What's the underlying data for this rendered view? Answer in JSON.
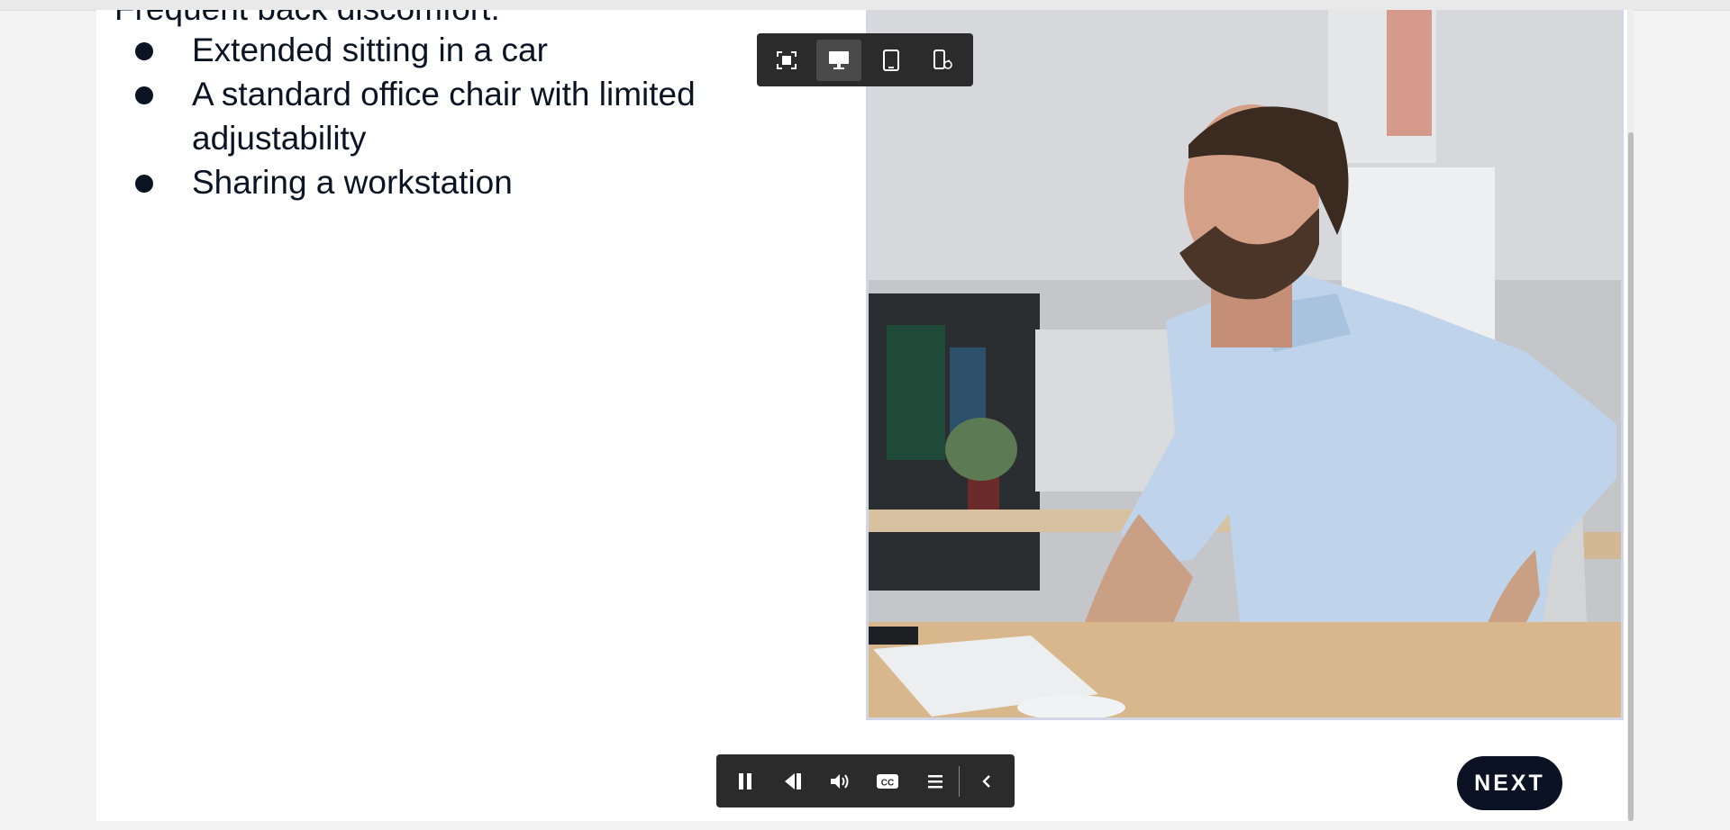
{
  "slide": {
    "cut_line": "Frequent back discomfort:",
    "bullets": [
      {
        "text": "Extended sitting in a car"
      },
      {
        "text": "A standard office chair with limited adjustability"
      },
      {
        "text": "Sharing a workstation"
      }
    ]
  },
  "preview_toolbar": {
    "buttons": [
      "fit-screen-icon",
      "desktop-icon",
      "tablet-icon",
      "mobile-rotate-icon"
    ],
    "active": "desktop-icon"
  },
  "player_controls": {
    "buttons": [
      "pause-icon",
      "replay-icon",
      "volume-icon",
      "closed-captions-icon",
      "menu-icon",
      "collapse-chevron-icon"
    ],
    "cc_label": "CC"
  },
  "next_button": {
    "label": "NEXT"
  },
  "colors": {
    "text": "#0b1423",
    "toolbar_bg": "#2b2b2b",
    "next_bg": "#0a1224",
    "photo_border": "#d3d6e6"
  }
}
